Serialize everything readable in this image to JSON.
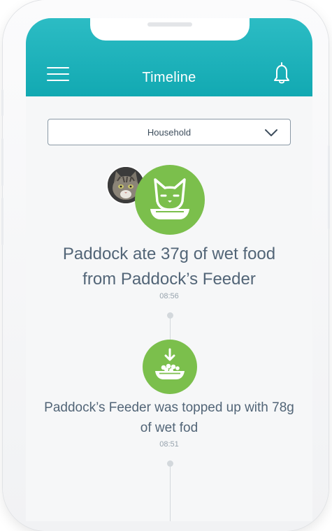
{
  "header": {
    "title": "Timeline",
    "background_color": "#14aab3",
    "menu_icon": "hamburger-menu-icon",
    "notification_icon": "bell-icon"
  },
  "filter": {
    "selected": "Household",
    "icon": "chevron-down-icon"
  },
  "timeline": [
    {
      "title_line1": "Paddock ate 37g of wet food",
      "title_line2": "from Paddock’s Feeder",
      "time": "08:56",
      "icon": "cat-eating-bowl-icon",
      "icon_color": "#7bbf4c",
      "avatar": "cat-photo-avatar"
    },
    {
      "title_line1": "Paddock’s Feeder was topped up with 78g",
      "title_line2": "of wet fod",
      "time": "08:51",
      "icon": "bowl-refill-icon",
      "icon_color": "#7bbf4c"
    }
  ]
}
